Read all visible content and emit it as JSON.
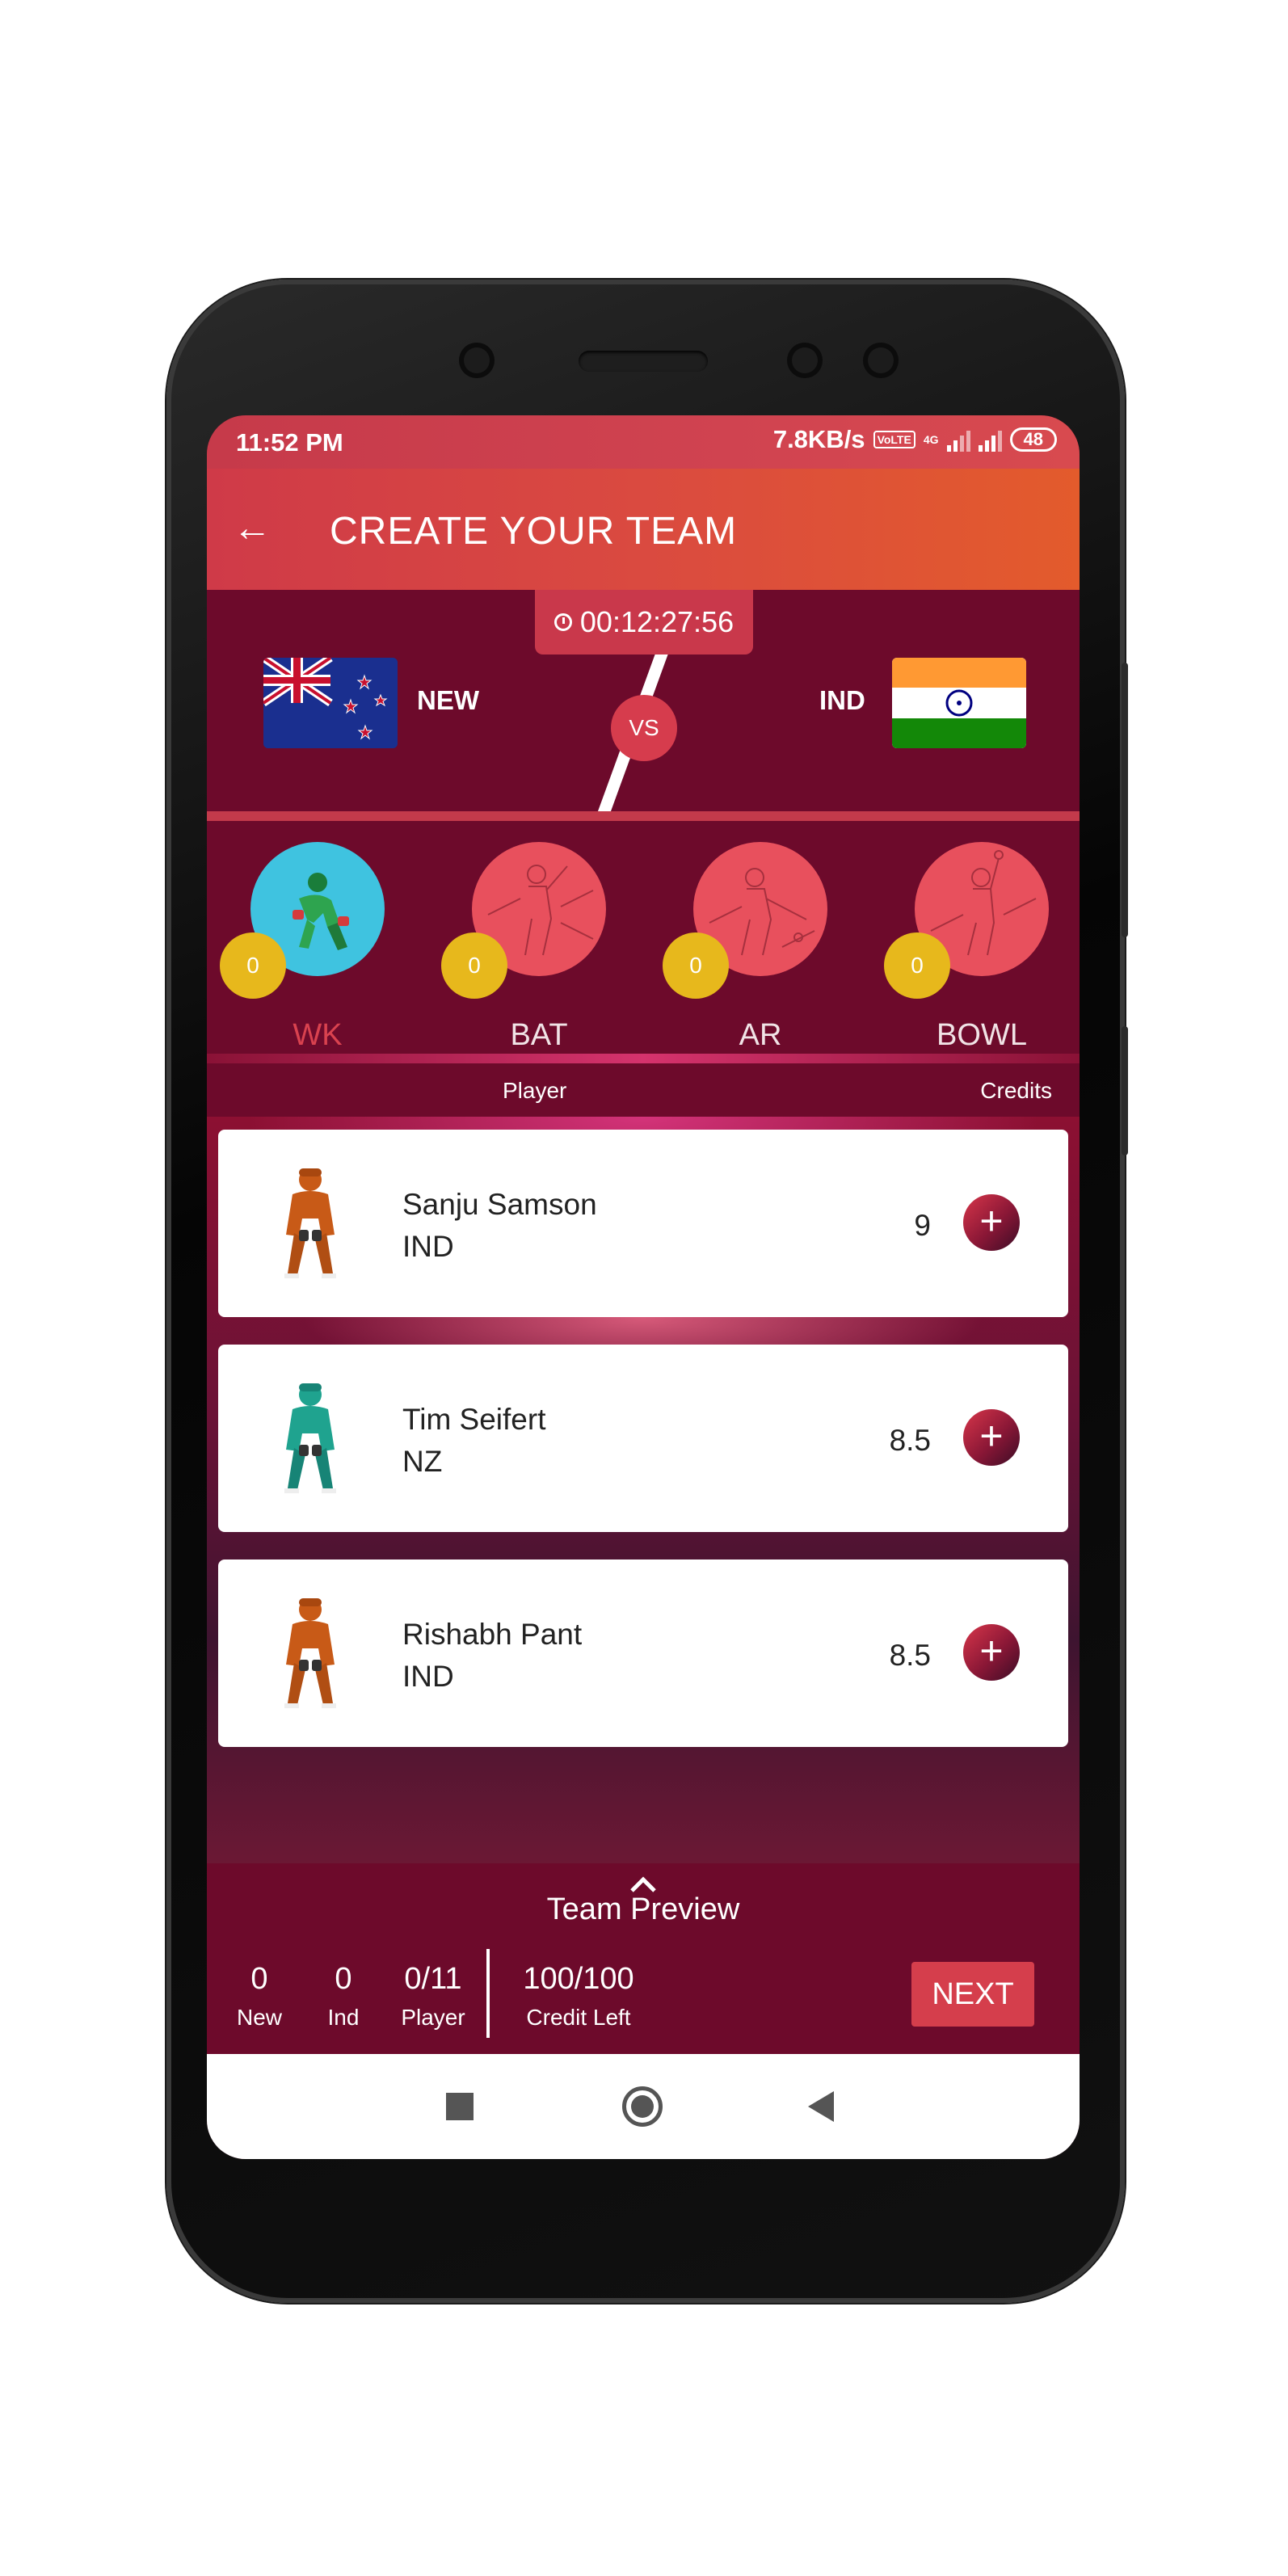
{
  "status_bar": {
    "time": "11:52 PM",
    "speed": "7.8KB/s",
    "network_badge": "VoLTE",
    "network_type": "4G",
    "battery": "48"
  },
  "app_bar": {
    "title": "CREATE YOUR TEAM"
  },
  "match": {
    "timer": "00:12:27:56",
    "team1": {
      "code": "NEW"
    },
    "team2": {
      "code": "IND"
    },
    "vs_label": "VS"
  },
  "categories": [
    {
      "label": "WK",
      "count": "0",
      "active": true
    },
    {
      "label": "BAT",
      "count": "0",
      "active": false
    },
    {
      "label": "AR",
      "count": "0",
      "active": false
    },
    {
      "label": "BOWL",
      "count": "0",
      "active": false
    }
  ],
  "columns": {
    "player": "Player",
    "credits": "Credits"
  },
  "players": [
    {
      "name": "Sanju Samson",
      "team": "IND",
      "credits": "9",
      "jersey_color": "#c85a17"
    },
    {
      "name": "Tim Seifert",
      "team": "NZ",
      "credits": "8.5",
      "jersey_color": "#1fa38f"
    },
    {
      "name": "Rishabh Pant",
      "team": "IND",
      "credits": "8.5",
      "jersey_color": "#c85a17"
    }
  ],
  "footer": {
    "preview_label": "Team Preview",
    "stats": [
      {
        "value": "0",
        "label": "New"
      },
      {
        "value": "0",
        "label": "Ind"
      },
      {
        "value": "0/11",
        "label": "Player"
      },
      {
        "value": "100/100",
        "label": "Credit Left"
      }
    ],
    "next_label": "NEXT"
  },
  "colors": {
    "primary": "#6d0a2b",
    "accent": "#d53e4c",
    "header_end": "#e35b2c",
    "coin": "#e7b81c"
  }
}
